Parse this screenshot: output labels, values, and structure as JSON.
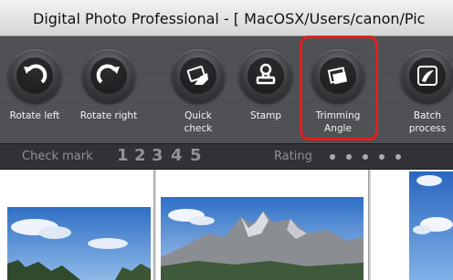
{
  "window": {
    "title": "Digital Photo Professional - [ MacOSX/Users/canon/Pic"
  },
  "toolbar": {
    "buttons": [
      {
        "id": "rotate-left",
        "line1": "Rotate left",
        "line2": "",
        "icon": "rotate-left-icon"
      },
      {
        "id": "rotate-right",
        "line1": "Rotate right",
        "line2": "",
        "icon": "rotate-right-icon"
      },
      {
        "id": "quick-check",
        "line1": "Quick",
        "line2": "check",
        "icon": "quick-check-icon"
      },
      {
        "id": "stamp",
        "line1": "Stamp",
        "line2": "",
        "icon": "stamp-icon"
      },
      {
        "id": "trimming-angle",
        "line1": "Trimming",
        "line2": "Angle",
        "icon": "trimming-angle-icon"
      },
      {
        "id": "batch-process",
        "line1": "Batch",
        "line2": "process",
        "icon": "batch-process-icon"
      }
    ],
    "highlighted": "trimming-angle",
    "highlight_color": "#e41e1e"
  },
  "checkbar": {
    "check_mark_label": "Check mark",
    "check_numbers": [
      "1",
      "2",
      "3",
      "4",
      "5"
    ],
    "rating_label": "Rating",
    "rating_dots": 5
  },
  "thumbnails": [
    {
      "id": "thumb-1",
      "subject": "sky and trees"
    },
    {
      "id": "thumb-2",
      "subject": "mountain peaks"
    },
    {
      "id": "thumb-3",
      "subject": "sky with clouds"
    }
  ],
  "colors": {
    "toolbar_bg": "#4d4f52",
    "checkbar_bg": "#2e3033",
    "label_text": "#f4f4f4",
    "dim_text": "#8f9296"
  }
}
